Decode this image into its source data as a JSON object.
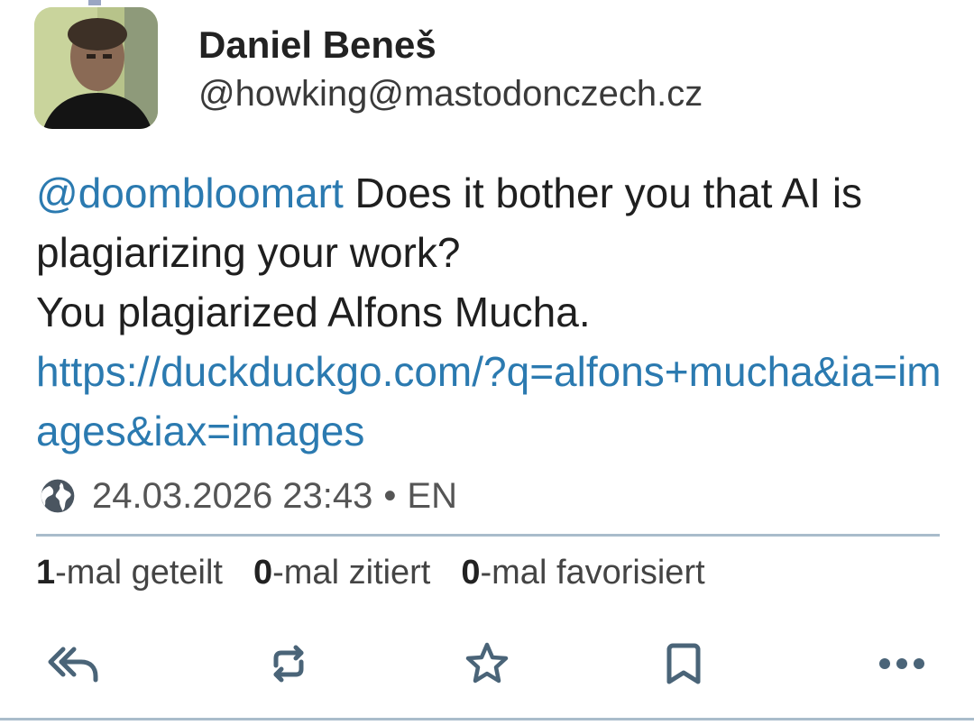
{
  "post": {
    "author": {
      "display_name": "Daniel Beneš",
      "handle": "@howking@mastodonczech.cz"
    },
    "content": {
      "mention": "@doombloomart",
      "line1": " Does it bother you that AI is plagiarizing your work?",
      "line2": "You plagiarized Alfons Mucha.",
      "link": "https://duckduckgo.com/?q=alfons+mucha&ia=images&iax=images"
    },
    "meta": {
      "visibility_icon": "globe-icon",
      "timestamp": "24.03.2026 23:43",
      "separator": "•",
      "language": "EN"
    },
    "stats": {
      "boosts_count": "1",
      "boosts_label": "-mal geteilt",
      "quotes_count": "0",
      "quotes_label": "-mal zitiert",
      "favourites_count": "0",
      "favourites_label": "-mal favorisiert"
    },
    "actions": {
      "reply_icon": "reply-all-icon",
      "boost_icon": "boost-icon",
      "favourite_icon": "star-icon",
      "bookmark_icon": "bookmark-icon",
      "more_icon": "more-icon"
    }
  },
  "colors": {
    "link": "#2b7ab0",
    "divider": "#a9bccb",
    "icon": "#4a6478"
  }
}
